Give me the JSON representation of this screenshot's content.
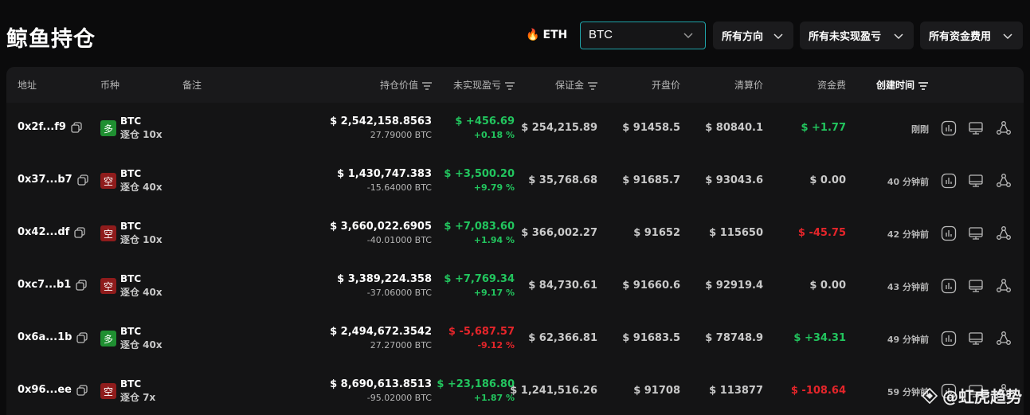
{
  "header": {
    "title": "鲸鱼持仓",
    "eth_label": "ETH",
    "search_value": "BTC",
    "filters": [
      "所有方向",
      "所有未实现盈亏",
      "所有资金费用"
    ]
  },
  "table": {
    "columns": {
      "address": "地址",
      "coin": "币种",
      "note": "备注",
      "value": "持仓价值",
      "pnl": "未实现盈亏",
      "margin": "保证金",
      "open": "开盘价",
      "liq": "清算价",
      "funding": "资金费",
      "created": "创建时间"
    },
    "rows": [
      {
        "address": "0x2f...f9",
        "side": "多",
        "coin": "BTC",
        "lev": "逐仓 10x",
        "value": "$ 2,542,158.8563",
        "size": "27.79000 BTC",
        "pnl": "$ +456.69",
        "pnl_pct": "+0.18 %",
        "margin": "$ 254,215.89",
        "open": "$ 91458.5",
        "liq": "$ 80840.1",
        "funding": "$ +1.77",
        "time": "刚刚"
      },
      {
        "address": "0x37...b7",
        "side": "空",
        "coin": "BTC",
        "lev": "逐仓 40x",
        "value": "$ 1,430,747.383",
        "size": "-15.64000 BTC",
        "pnl": "$ +3,500.20",
        "pnl_pct": "+9.79 %",
        "margin": "$ 35,768.68",
        "open": "$ 91685.7",
        "liq": "$ 93043.6",
        "funding": "$ 0.00",
        "time": "40 分钟前"
      },
      {
        "address": "0x42...df",
        "side": "空",
        "coin": "BTC",
        "lev": "逐仓 10x",
        "value": "$ 3,660,022.6905",
        "size": "-40.01000 BTC",
        "pnl": "$ +7,083.60",
        "pnl_pct": "+1.94 %",
        "margin": "$ 366,002.27",
        "open": "$ 91652",
        "liq": "$ 115650",
        "funding": "$ -45.75",
        "time": "42 分钟前"
      },
      {
        "address": "0xc7...b1",
        "side": "空",
        "coin": "BTC",
        "lev": "逐仓 40x",
        "value": "$ 3,389,224.358",
        "size": "-37.06000 BTC",
        "pnl": "$ +7,769.34",
        "pnl_pct": "+9.17 %",
        "margin": "$ 84,730.61",
        "open": "$ 91660.6",
        "liq": "$ 92919.4",
        "funding": "$ 0.00",
        "time": "43 分钟前"
      },
      {
        "address": "0x6a...1b",
        "side": "多",
        "coin": "BTC",
        "lev": "逐仓 40x",
        "value": "$ 2,494,672.3542",
        "size": "27.27000 BTC",
        "pnl": "$ -5,687.57",
        "pnl_pct": "-9.12 %",
        "margin": "$ 62,366.81",
        "open": "$ 91683.5",
        "liq": "$ 78748.9",
        "funding": "$ +34.31",
        "time": "49 分钟前"
      },
      {
        "address": "0x96...ee",
        "side": "空",
        "coin": "BTC",
        "lev": "逐仓 7x",
        "value": "$ 8,690,613.8513",
        "size": "-95.02000 BTC",
        "pnl": "$ +23,186.80",
        "pnl_pct": "+1.87 %",
        "margin": "$ 1,241,516.26",
        "open": "$ 91708",
        "liq": "$ 113877",
        "funding": "$ -108.64",
        "time": "59 分钟前"
      }
    ]
  },
  "watermark": "@虹虎趋势",
  "colors": {
    "positive": "#22c55e",
    "negative": "#e5252a",
    "long_badge": "#1f8f31",
    "short_badge": "#8f1c1c",
    "accent_border": "#1fa3a8"
  }
}
